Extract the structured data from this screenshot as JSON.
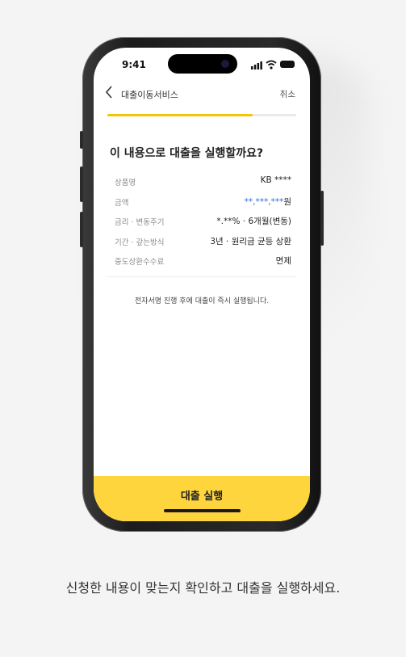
{
  "status": {
    "time": "9:41"
  },
  "header": {
    "back_icon": "chevron-left-icon",
    "title": "대출이동서비스",
    "cancel_label": "취소"
  },
  "progress": {
    "fraction": 0.77
  },
  "question": "이 내용으로 대출을 실행할까요?",
  "details": [
    {
      "label": "상품명",
      "value": "KB ****"
    },
    {
      "label": "금액",
      "value_masked": "**,***,***",
      "value_suffix": "원"
    },
    {
      "label": "금리 · 변동주기",
      "value": "*.**% · 6개월(변동)"
    },
    {
      "label": "기간 · 갚는방식",
      "value": "3년 · 원리금 균등 상환"
    },
    {
      "label": "중도상환수수료",
      "value": "면제"
    }
  ],
  "notice": "전자서명 진행 후에 대출이 즉시 실행됩니다.",
  "cta_label": "대출 실행",
  "caption": "신청한 내용이 맞는지 확인하고 대출을 실행하세요.",
  "colors": {
    "accent": "#ffd53d",
    "progress": "#f5c400",
    "masked_value": "#2f6fe0"
  }
}
